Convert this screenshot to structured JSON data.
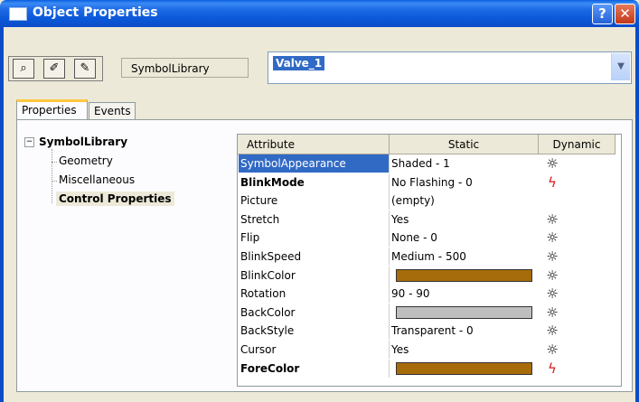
{
  "window": {
    "title": "Object Properties"
  },
  "toolbar": {
    "library_label": "SymbolLibrary",
    "object_name": "Valve_1"
  },
  "tabs": [
    {
      "label": "Properties"
    },
    {
      "label": "Events"
    }
  ],
  "tree": {
    "root": "SymbolLibrary",
    "items": [
      "Geometry",
      "Miscellaneous",
      "Control Properties"
    ],
    "selected": "Control Properties"
  },
  "grid": {
    "headers": {
      "attribute": "Attribute",
      "static": "Static",
      "dynamic": "Dynamic"
    },
    "rows": [
      {
        "attr": "SymbolAppearance",
        "value": "Shaded - 1",
        "dynamic": "bulb",
        "bold": false,
        "selected": true
      },
      {
        "attr": "BlinkMode",
        "value": "No Flashing - 0",
        "dynamic": "bolt",
        "bold": true
      },
      {
        "attr": "Picture",
        "value": "(empty)",
        "dynamic": ""
      },
      {
        "attr": "Stretch",
        "value": "Yes",
        "dynamic": "bulb"
      },
      {
        "attr": "Flip",
        "value": "None - 0",
        "dynamic": "bulb"
      },
      {
        "attr": "BlinkSpeed",
        "value": "Medium - 500",
        "dynamic": "bulb"
      },
      {
        "attr": "BlinkColor",
        "value": "",
        "color": "#A66B0A",
        "dynamic": "bulb"
      },
      {
        "attr": "Rotation",
        "value": "90 - 90",
        "dynamic": "bulb"
      },
      {
        "attr": "BackColor",
        "value": "",
        "color": "#BEBEBE",
        "dynamic": "bulb"
      },
      {
        "attr": "BackStyle",
        "value": "Transparent - 0",
        "dynamic": "bulb"
      },
      {
        "attr": "Cursor",
        "value": "Yes",
        "dynamic": "bulb"
      },
      {
        "attr": "ForeColor",
        "value": "",
        "color": "#A66B0A",
        "dynamic": "bolt",
        "bold": true
      }
    ]
  },
  "icons": {
    "bulb": "bulb-icon",
    "bolt": "lightning-icon"
  },
  "colors": {
    "title_bar": "#0A58D8",
    "selection": "#316AC5",
    "tab_accent": "#FFC83C"
  }
}
